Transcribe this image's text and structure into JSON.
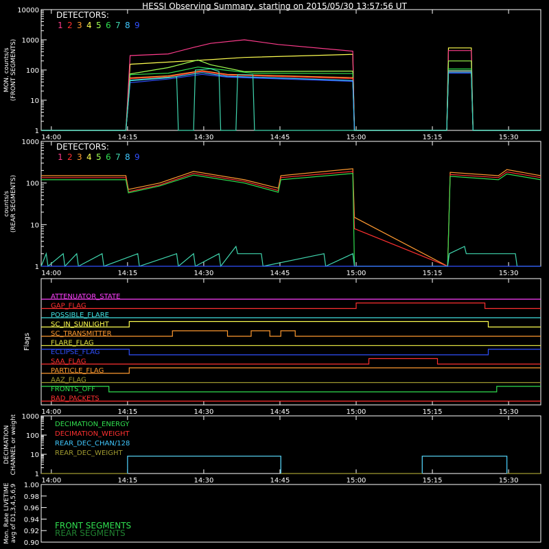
{
  "title": "HESSI Observing Summary, starting on 2015/05/30 13:57:56 UT",
  "colors": {
    "axis": "#ffffff",
    "d1": "#ff3c8c",
    "d2": "#ff3030",
    "d3": "#ff9a30",
    "d4": "#ffff50",
    "d5": "#a0ff50",
    "d6": "#30e050",
    "d7": "#40d8b0",
    "d8": "#40c8ff",
    "d9": "#3050ff"
  },
  "time_ticks": [
    "14:00",
    "14:15",
    "14:30",
    "14:45",
    "15:00",
    "15:15",
    "15:30"
  ],
  "time_ticks_min": [
    120,
    1020,
    1920,
    2820,
    3720,
    4620,
    5520
  ],
  "detectors": {
    "label": "DETECTORS:",
    "numbers": [
      "1",
      "2",
      "3",
      "4",
      "5",
      "6",
      "7",
      "8",
      "9"
    ]
  },
  "chart_data": [
    {
      "type": "line",
      "name": "front",
      "ylabel_lines": [
        "MON. counts/s",
        "(FRONT SEGMENTS)"
      ],
      "ylog": true,
      "ylim": [
        1,
        10000
      ],
      "ytick_labels": [
        "1",
        "10",
        "100",
        "1000",
        "10000"
      ],
      "series": [
        {
          "color": "d4",
          "x": [
            0,
            1000,
            1050,
            1800,
            2000,
            2400,
            3680,
            3700,
            4790,
            4810,
            5080,
            5100,
            5900
          ],
          "y": [
            1,
            1,
            155,
            205,
            220,
            260,
            330,
            1,
            1,
            540,
            540,
            1,
            1
          ]
        },
        {
          "color": "d1",
          "x": [
            0,
            1000,
            1050,
            1500,
            1800,
            2000,
            2400,
            2800,
            3680,
            3700,
            4790,
            4810,
            5080,
            5100,
            5900
          ],
          "y": [
            1,
            1,
            300,
            340,
            560,
            760,
            1000,
            700,
            420,
            1,
            1,
            440,
            440,
            1,
            1
          ]
        },
        {
          "color": "d5",
          "x": [
            0,
            1000,
            1050,
            1500,
            1850,
            2000,
            2400,
            3680,
            3700,
            4790,
            4810,
            5080,
            5100,
            5900
          ],
          "y": [
            1,
            1,
            74,
            120,
            215,
            150,
            88,
            92,
            1,
            1,
            200,
            200,
            1,
            1
          ]
        },
        {
          "color": "d6",
          "x": [
            0,
            1000,
            1050,
            1500,
            1850,
            2100,
            2500,
            3680,
            3700,
            4790,
            4810,
            5080,
            5100,
            5900
          ],
          "y": [
            1,
            1,
            70,
            78,
            125,
            105,
            78,
            76,
            1,
            1,
            108,
            108,
            1,
            1
          ]
        },
        {
          "color": "d3",
          "x": [
            0,
            1000,
            1050,
            1500,
            1900,
            2200,
            3680,
            3700,
            4790,
            4810,
            5080,
            5100,
            5900
          ],
          "y": [
            1,
            1,
            55,
            64,
            95,
            72,
            56,
            1,
            1,
            96,
            96,
            1,
            1
          ]
        },
        {
          "color": "d2",
          "x": [
            0,
            1000,
            1050,
            1500,
            1900,
            2200,
            3680,
            3700,
            4790,
            4810,
            5080,
            5100,
            5900
          ],
          "y": [
            1,
            1,
            52,
            60,
            90,
            68,
            52,
            1,
            1,
            92,
            92,
            1,
            1
          ]
        },
        {
          "color": "d9",
          "x": [
            0,
            1000,
            1050,
            1500,
            1900,
            2200,
            3680,
            3700,
            4790,
            4810,
            5080,
            5100,
            5900
          ],
          "y": [
            1,
            1,
            38,
            50,
            72,
            58,
            42,
            1,
            1,
            78,
            78,
            1,
            1
          ]
        },
        {
          "color": "d8",
          "x": [
            0,
            1000,
            1050,
            1500,
            1900,
            2200,
            3680,
            3700,
            4790,
            4810,
            5080,
            5100,
            5900
          ],
          "y": [
            1,
            1,
            44,
            55,
            82,
            62,
            45,
            1,
            1,
            85,
            85,
            1,
            1
          ]
        },
        {
          "color": "d7",
          "x": [
            0,
            1000,
            1050,
            1600,
            1620,
            1800,
            1820,
            2000,
            2100,
            2120,
            2300,
            2320,
            2500,
            2520,
            3680,
            3700,
            4790,
            4810,
            5080,
            5100,
            5900
          ],
          "y": [
            1,
            1,
            46,
            60,
            1,
            1,
            100,
            110,
            90,
            1,
            1,
            70,
            70,
            1,
            1,
            1,
            1,
            95,
            95,
            1,
            1
          ]
        }
      ]
    },
    {
      "type": "line",
      "name": "rear",
      "ylabel_lines": [
        "counts/s",
        "(REAR SEGMENTS)"
      ],
      "ylog": true,
      "ylim": [
        1,
        1000
      ],
      "ytick_labels": [
        "1",
        "10",
        "100",
        "1000"
      ],
      "series": [
        {
          "color": "d3",
          "x": [
            0,
            1000,
            1030,
            1400,
            1800,
            2400,
            2800,
            2830,
            3680,
            3700,
            4800,
            4830,
            5400,
            5500,
            5900
          ],
          "y": [
            150,
            150,
            70,
            100,
            190,
            120,
            75,
            150,
            220,
            15,
            1,
            180,
            150,
            210,
            150
          ]
        },
        {
          "color": "d2",
          "x": [
            0,
            1000,
            1030,
            1400,
            1800,
            2400,
            2800,
            2830,
            3680,
            3700,
            4800,
            4830,
            5400,
            5500,
            5900
          ],
          "y": [
            135,
            135,
            62,
            90,
            170,
            110,
            66,
            135,
            190,
            8,
            1,
            160,
            135,
            185,
            135
          ]
        },
        {
          "color": "d6",
          "x": [
            0,
            1000,
            1030,
            1400,
            1800,
            2400,
            2800,
            2830,
            3680,
            3700,
            4800,
            4830,
            5400,
            5500,
            5900
          ],
          "y": [
            120,
            120,
            58,
            85,
            155,
            100,
            60,
            120,
            170,
            1,
            1,
            145,
            120,
            165,
            120
          ]
        },
        {
          "color": "d7",
          "x": [
            0,
            60,
            80,
            260,
            280,
            420,
            440,
            720,
            740,
            1140,
            1160,
            1600,
            1620,
            1800,
            1820,
            2100,
            2120,
            2300,
            2320,
            2600,
            2620,
            3340,
            3360,
            3680,
            3700,
            4800,
            4820,
            5000,
            5020,
            5600,
            5620,
            5900
          ],
          "y": [
            1,
            2,
            1,
            2,
            1,
            2,
            1,
            2,
            1,
            2,
            1,
            2,
            1,
            2,
            1,
            2,
            1,
            3,
            2,
            2,
            1,
            2,
            1,
            2,
            1,
            1,
            2,
            3,
            2,
            2,
            1,
            1
          ]
        },
        {
          "color": "d9",
          "x": [
            0,
            5900
          ],
          "y": [
            1,
            1
          ]
        }
      ]
    }
  ],
  "flags": {
    "ylabel": "Flags",
    "items": [
      {
        "label": "ATTENUATOR_STATE",
        "color": "#ff40ff",
        "x": [
          0,
          5900
        ],
        "level": [
          0,
          0
        ]
      },
      {
        "label": "GAP_FLAG",
        "color": "#ff3030",
        "x": [
          0,
          3720,
          3720,
          5240,
          5240,
          5900
        ],
        "level": [
          0,
          0,
          1,
          1,
          0,
          0
        ]
      },
      {
        "label": "POSSIBLE_FLARE",
        "color": "#40e0e0",
        "x": [
          0,
          5900
        ],
        "level": [
          0,
          0
        ]
      },
      {
        "label": "SC_IN_SUNLIGHT",
        "color": "#ffff50",
        "x": [
          0,
          1040,
          1040,
          5280,
          5280,
          5900
        ],
        "level": [
          0,
          0,
          1,
          1,
          0,
          0
        ]
      },
      {
        "label": "SC_TRANSMITTER",
        "color": "#ff9a30",
        "x": [
          0,
          1550,
          1550,
          2200,
          2200,
          2480,
          2480,
          2700,
          2700,
          2830,
          2830,
          3000,
          3000,
          5900
        ],
        "level": [
          0,
          0,
          1,
          1,
          0,
          0,
          1,
          1,
          0,
          0,
          1,
          1,
          0,
          0
        ]
      },
      {
        "label": "FLARE_FLAG",
        "color": "#e0e040",
        "x": [
          0,
          5900
        ],
        "level": [
          0,
          0
        ]
      },
      {
        "label": "ECLIPSE_FLAG",
        "color": "#3050ff",
        "x": [
          0,
          1040,
          1040,
          5280,
          5280,
          5900
        ],
        "level": [
          1,
          1,
          0,
          0,
          1,
          1
        ]
      },
      {
        "label": "SAA_FLAG",
        "color": "#ff3030",
        "x": [
          0,
          3870,
          3870,
          4680,
          4680,
          5900
        ],
        "level": [
          0,
          0,
          1,
          1,
          0,
          0
        ]
      },
      {
        "label": "PARTICLE_FLAG",
        "color": "#ff9a30",
        "x": [
          0,
          1040,
          1040,
          5900
        ],
        "level": [
          0,
          0,
          1,
          1
        ]
      },
      {
        "label": "AAZ_FLAG",
        "color": "#a09a30",
        "x": [
          0,
          5900
        ],
        "level": [
          0,
          0
        ]
      },
      {
        "label": "FRONTS_OFF",
        "color": "#30e050",
        "x": [
          0,
          800,
          800,
          5380,
          5380,
          5900
        ],
        "level": [
          1,
          1,
          0,
          0,
          1,
          1
        ]
      },
      {
        "label": "BAD_PACKETS",
        "color": "#ff3030",
        "x": [
          0,
          5900
        ],
        "level": [
          0,
          0
        ]
      }
    ]
  },
  "decimation": {
    "ylabel_lines": [
      "DECIMATION",
      "CHANNEL or weight"
    ],
    "ytick_labels": [
      "1",
      "10",
      "100",
      "1000"
    ],
    "ylim": [
      1,
      1000
    ],
    "legend": [
      {
        "label": "DECIMATION_ENERGY",
        "color": "#30e050"
      },
      {
        "label": "DECIMATION_WEIGHT",
        "color": "#ff3030"
      },
      {
        "label": "REAR_DEC_CHAN/128",
        "color": "#40c8ff"
      },
      {
        "label": "REAR_DEC_WEIGHT",
        "color": "#a09a30"
      }
    ],
    "series": [
      {
        "color": "#a09a30",
        "x": [
          0,
          1020,
          1020,
          2830,
          2830,
          4500,
          4500,
          5500,
          5500,
          5900
        ],
        "y": [
          1,
          1,
          8,
          8,
          1,
          1,
          8,
          8,
          1,
          1
        ]
      },
      {
        "color": "#40c8ff",
        "x": [
          1020,
          1020,
          2830,
          2830
        ],
        "y": [
          1,
          8,
          8,
          1
        ]
      },
      {
        "color": "#40c8ff",
        "x": [
          4500,
          4500,
          5500,
          5500
        ],
        "y": [
          1,
          8,
          8,
          1
        ]
      }
    ]
  },
  "livetime": {
    "ylabel_lines": [
      "Mon. Rate LIVETIME",
      "avg of D1,3,4,5,6,9"
    ],
    "ytick_labels": [
      "0.90",
      "0.92",
      "0.94",
      "0.96",
      "0.98",
      "1.00"
    ],
    "ylim": [
      0.9,
      1.0
    ],
    "legend": [
      {
        "label": "FRONT SEGMENTS",
        "color": "#30e050"
      },
      {
        "label": "REAR SEGMENTS",
        "color": "#208030"
      }
    ]
  }
}
